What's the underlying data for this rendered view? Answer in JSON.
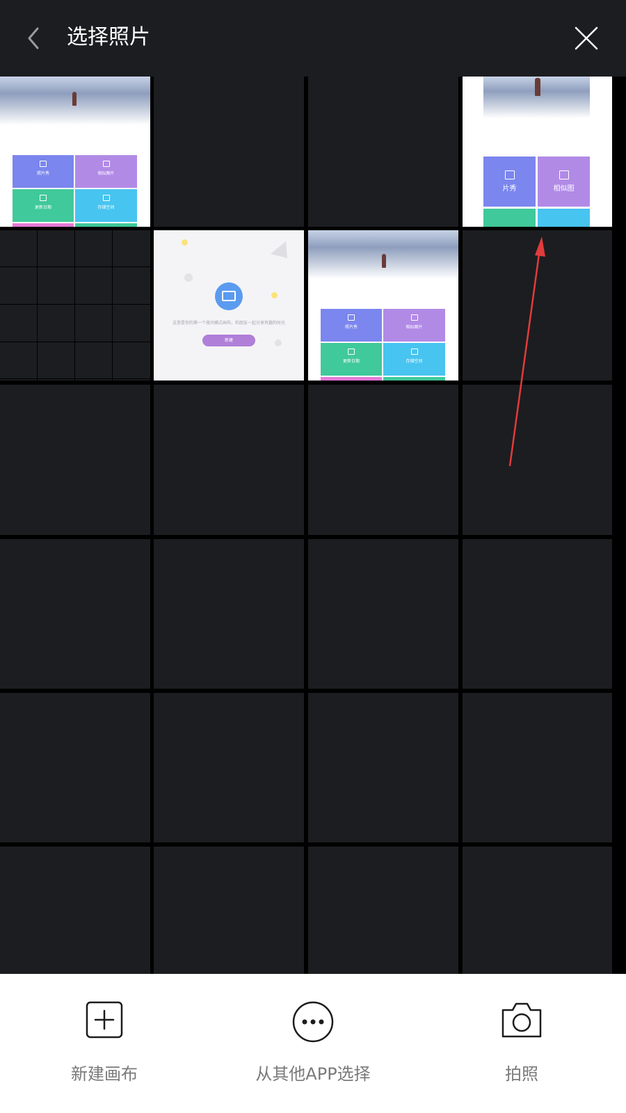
{
  "header": {
    "title": "选择照片",
    "back_icon": "chevron-left-icon",
    "close_icon": "close-icon"
  },
  "thumbnails": {
    "app_tiles": [
      "照片秀",
      "相似图片",
      "更新日期",
      "存储空间"
    ],
    "tile4_partial": [
      "片秀",
      "相似图"
    ],
    "empty_state_text": "这里是你的第一个夜间模式画布，和朋友一起分享有趣的时光",
    "empty_state_button": "新建"
  },
  "bottom_actions": [
    {
      "label": "新建画布",
      "icon": "plus-square-icon"
    },
    {
      "label": "从其他APP选择",
      "icon": "more-circle-icon"
    },
    {
      "label": "拍照",
      "icon": "camera-icon"
    }
  ],
  "colors": {
    "header_bg": "#1c1d20",
    "tile_bg": "#1c1d20",
    "annotation_arrow": "#e23b3b",
    "tile_blue": "#7b86ee",
    "tile_purple": "#b18ae6",
    "tile_green": "#40c99a",
    "tile_cyan": "#48c4f0"
  }
}
